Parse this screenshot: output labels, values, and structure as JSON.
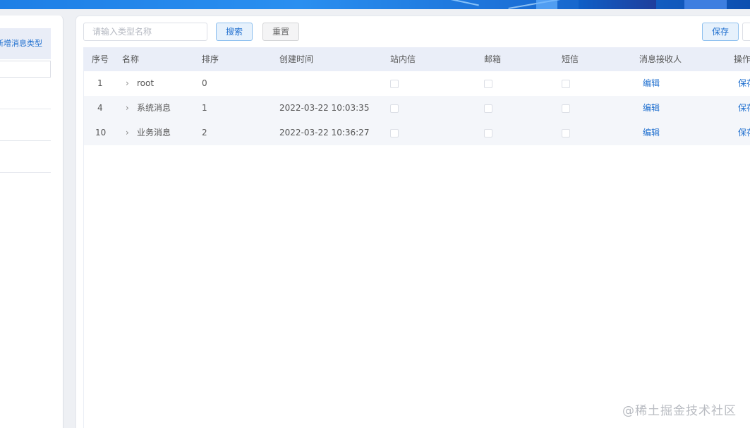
{
  "left": {
    "add_type_label": "新增消息类型"
  },
  "toolbar": {
    "search_placeholder": "请输入类型名称",
    "search_label": "搜索",
    "reset_label": "重置",
    "save_label": "保存"
  },
  "table": {
    "headers": {
      "index": "序号",
      "name": "名称",
      "sort": "排序",
      "created": "创建时间",
      "site_msg": "站内信",
      "email": "邮箱",
      "sms": "短信",
      "receiver": "消息接收人",
      "ops": "操作"
    },
    "rows": [
      {
        "index": "1",
        "name": "root",
        "sort": "0",
        "created": "",
        "receiver_action": "编辑",
        "op_action": "保存"
      },
      {
        "index": "4",
        "name": "系统消息",
        "sort": "1",
        "created": "2022-03-22 10:03:35",
        "receiver_action": "编辑",
        "op_action": "保存"
      },
      {
        "index": "10",
        "name": "业务消息",
        "sort": "2",
        "created": "2022-03-22 10:36:27",
        "receiver_action": "编辑",
        "op_action": "保存"
      }
    ]
  },
  "watermark": "@稀土掘金技术社区",
  "colors": {
    "accent": "#1f6fcf",
    "header_bg": "#eaeef8",
    "banner": "#1e7fe6"
  }
}
